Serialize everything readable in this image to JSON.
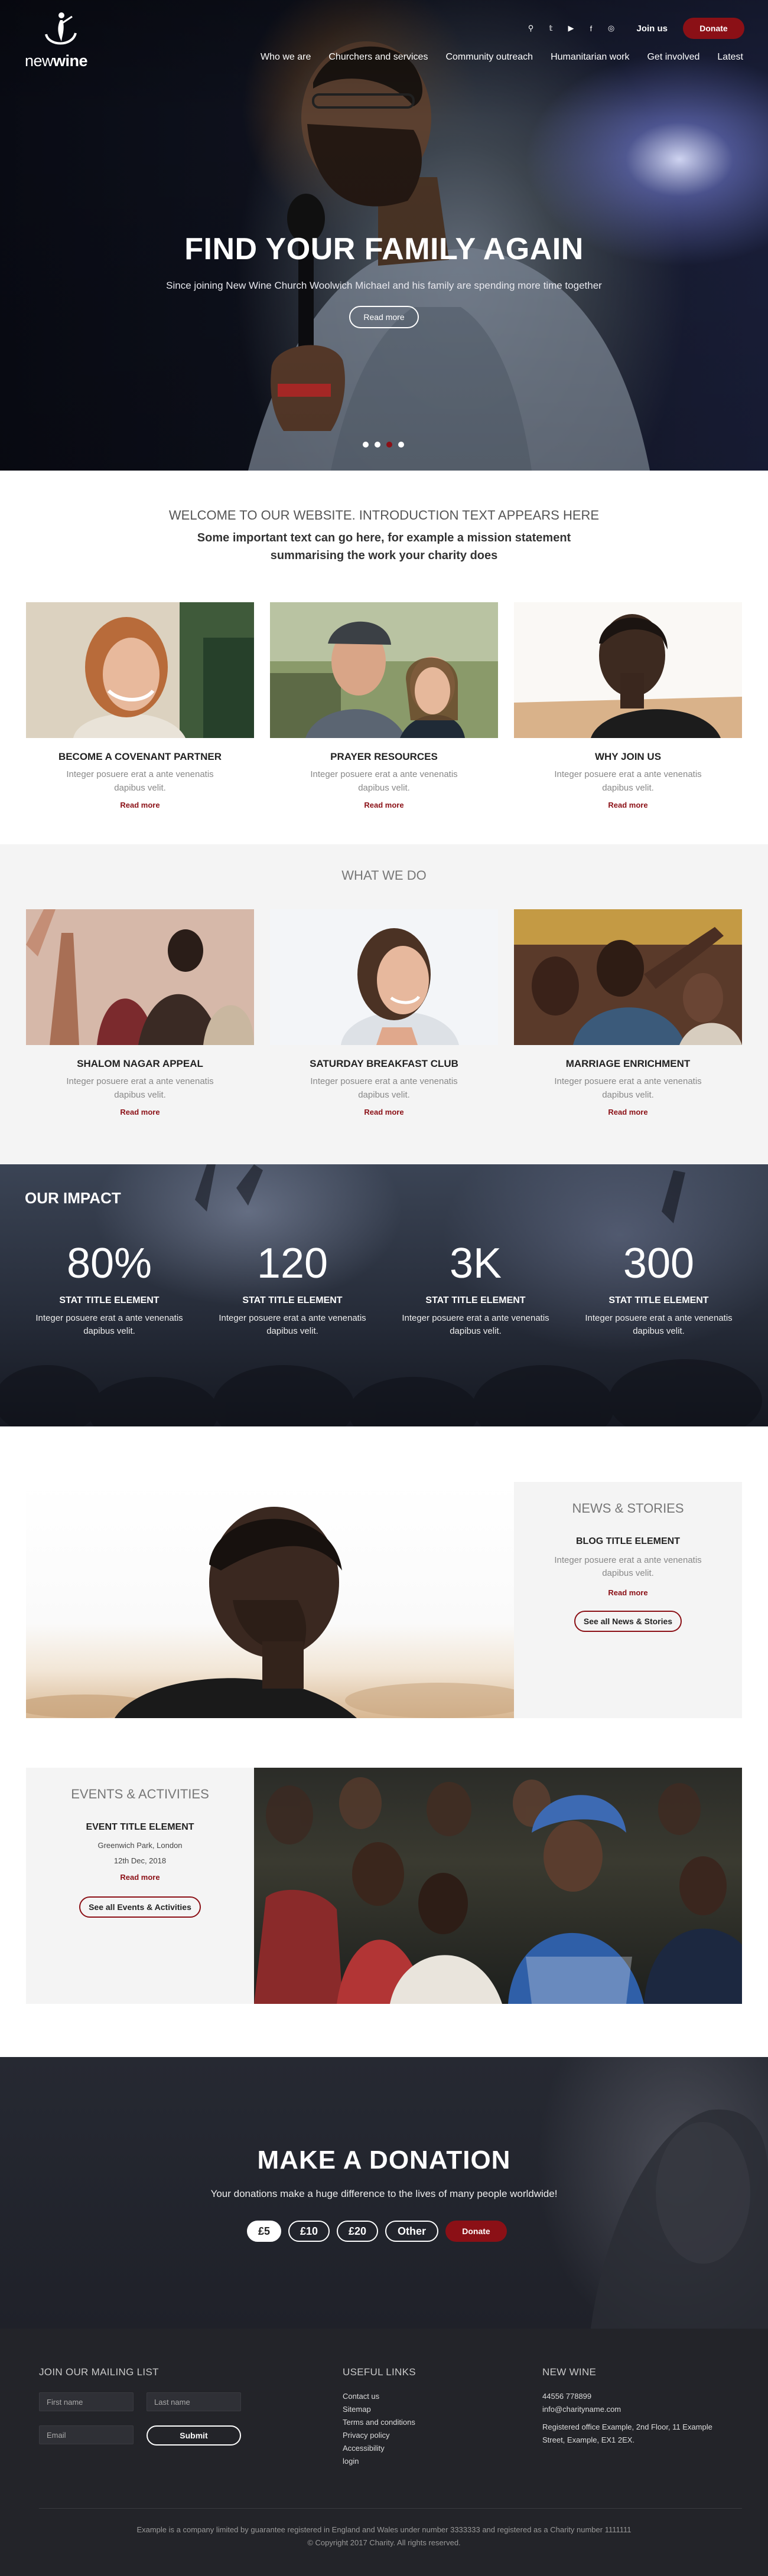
{
  "brand": {
    "logo_text_light": "new",
    "logo_text_bold": "wine"
  },
  "header": {
    "icons": [
      "search-icon",
      "twitter-icon",
      "youtube-icon",
      "facebook-icon",
      "instagram-icon"
    ],
    "icon_glyphs": [
      "⚲",
      "𝕥",
      "▶",
      "f",
      "◎"
    ],
    "join_label": "Join us",
    "donate_label": "Donate",
    "nav": [
      "Who we are",
      "Churchers and services",
      "Community outreach",
      "Humanitarian work",
      "Get involved",
      "Latest"
    ]
  },
  "hero": {
    "title": "FIND YOUR FAMILY AGAIN",
    "subtitle": "Since joining New Wine Church Woolwich Michael and his family are spending more time together",
    "button": "Read more",
    "slides": 4,
    "active_slide": 3
  },
  "welcome": {
    "heading": "WELCOME TO OUR WEBSITE. INTRODUCTION TEXT APPEARS HERE",
    "text": "Some important text can go here, for example a mission statement summarising the work your charity does"
  },
  "intro_cards": [
    {
      "title": "BECOME A COVENANT PARTNER",
      "desc": "Integer posuere erat a ante venenatis dapibus velit.",
      "link": "Read more"
    },
    {
      "title": "PRAYER RESOURCES",
      "desc": "Integer posuere erat a ante venenatis dapibus velit.",
      "link": "Read more"
    },
    {
      "title": "WHY JOIN US",
      "desc": "Integer posuere erat a ante venenatis dapibus velit.",
      "link": "Read more"
    }
  ],
  "what_we_do": {
    "heading": "WHAT WE DO",
    "cards": [
      {
        "title": "SHALOM NAGAR APPEAL",
        "desc": "Integer posuere erat a ante venenatis dapibus velit.",
        "link": "Read more"
      },
      {
        "title": "SATURDAY BREAKFAST CLUB",
        "desc": "Integer posuere erat a ante venenatis dapibus velit.",
        "link": "Read more"
      },
      {
        "title": "MARRIAGE ENRICHMENT",
        "desc": "Integer posuere erat a ante venenatis dapibus velit.",
        "link": "Read more"
      }
    ]
  },
  "impact": {
    "heading": "OUR IMPACT",
    "stats": [
      {
        "value": "80%",
        "title": "STAT TITLE ELEMENT",
        "desc": "Integer posuere erat a ante venenatis dapibus velit."
      },
      {
        "value": "120",
        "title": "STAT TITLE ELEMENT",
        "desc": "Integer posuere erat a ante venenatis dapibus velit."
      },
      {
        "value": "3K",
        "title": "STAT TITLE ELEMENT",
        "desc": "Integer posuere erat a ante venenatis dapibus velit."
      },
      {
        "value": "300",
        "title": "STAT TITLE ELEMENT",
        "desc": "Integer posuere erat a ante venenatis dapibus velit."
      }
    ]
  },
  "news": {
    "heading": "NEWS & STORIES",
    "title": "BLOG TITLE ELEMENT",
    "desc": "Integer posuere erat a ante venenatis dapibus velit.",
    "link": "Read more",
    "button": "See all News & Stories"
  },
  "events": {
    "heading": "EVENTS & ACTIVITIES",
    "title": "EVENT TITLE ELEMENT",
    "location": "Greenwich Park, London",
    "date": "12th Dec, 2018",
    "link": "Read more",
    "button": "See all Events & Activities"
  },
  "donation": {
    "heading": "MAKE A DONATION",
    "text": "Your donations make a huge difference to the lives of many people worldwide!",
    "amounts": [
      "£5",
      "£10",
      "£20",
      "Other"
    ],
    "selected": "£5",
    "button": "Donate"
  },
  "footer": {
    "mailing": {
      "heading": "JOIN OUR MAILING LIST",
      "first_name": "First name",
      "last_name": "Last name",
      "email": "Email",
      "submit": "Submit"
    },
    "links": {
      "heading": "USEFUL LINKS",
      "items": [
        "Contact us",
        "Sitemap",
        "Terms and conditions",
        "Privacy policy",
        "Accessibility",
        "login"
      ]
    },
    "contact": {
      "heading": "NEW WINE",
      "phone": "44556 778899",
      "email": "info@charityname.com",
      "address": "Registered office Example, 2nd Floor, 11 Example Street, Example, EX1 2EX."
    },
    "legal": "Example is a company limited by guarantee registered in England and Wales under number 3333333 and registered as a Charity number 1111111",
    "copyright": "© Copyright 2017 Charity. All rights reserved."
  },
  "colors": {
    "accent": "#8b1016",
    "dark": "#232429",
    "light_bg": "#f4f4f4"
  }
}
